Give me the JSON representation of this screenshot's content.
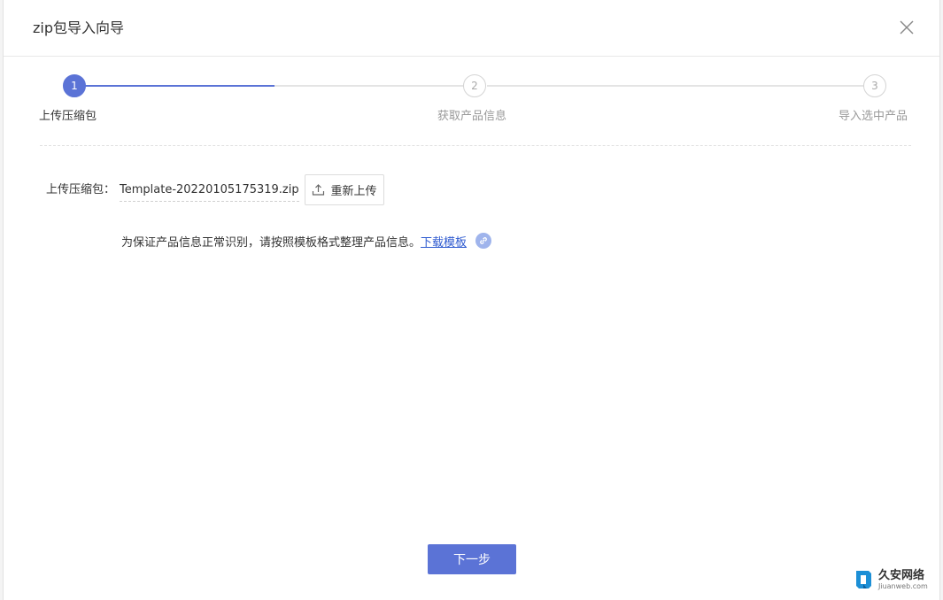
{
  "dialog": {
    "title": "zip包导入向导"
  },
  "steps": [
    {
      "number": "1",
      "label": "上传压缩包",
      "state": "active"
    },
    {
      "number": "2",
      "label": "获取产品信息",
      "state": "inactive"
    },
    {
      "number": "3",
      "label": "导入选中产品",
      "state": "inactive"
    }
  ],
  "upload": {
    "label": "上传压缩包：",
    "file_name": "Template-20220105175319.zip",
    "reupload_label": "重新上传"
  },
  "hint": {
    "text": "为保证产品信息正常识别，请按照模板格式整理产品信息。",
    "download_label": "下载模板"
  },
  "footer": {
    "next_label": "下一步"
  },
  "watermark": {
    "name": "久安网络",
    "domain": "Jiuanweb.com"
  },
  "colors": {
    "accent": "#5b73d6",
    "link": "#2f5bd0",
    "link_icon": "#9fb4ec"
  },
  "icons": {
    "close": "close-icon",
    "upload": "upload-icon",
    "link": "link-icon"
  }
}
